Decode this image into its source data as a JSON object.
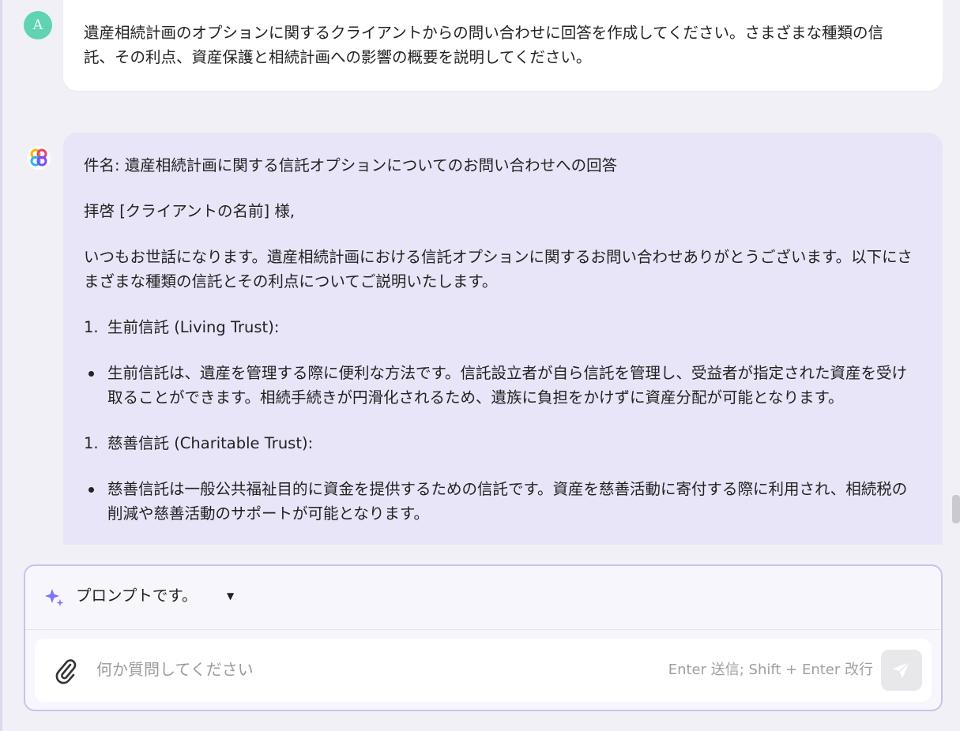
{
  "user": {
    "avatar_letter": "A",
    "message": "遺産相続計画のオプションに関するクライアントからの問い合わせに回答を作成してください。さまざまな種類の信託、その利点、資産保護と相続計画への影響の概要を説明してください。"
  },
  "assistant": {
    "subject": "件名: 遺産相続計画に関する信託オプションについてのお問い合わせへの回答",
    "greeting": "拝啓 [クライアントの名前] 様,",
    "intro": "いつもお世話になります。遺産相続計画における信託オプションに関するお問い合わせありがとうございます。以下にさまざまな種類の信託とその利点についてご説明いたします。",
    "items": [
      {
        "number": "1.",
        "title": "生前信託 (Living Trust):",
        "bullet": "生前信託は、遺産を管理する際に便利な方法です。信託設立者が自ら信託を管理し、受益者が指定された資産を受け取ることができます。相続手続きが円滑化されるため、遺族に負担をかけずに資産分配が可能となります。"
      },
      {
        "number": "1.",
        "title": "慈善信託 (Charitable Trust):",
        "bullet": "慈善信託は一般公共福祉目的に資金を提供するための信託です。資産を慈善活動に寄付する際に利用され、相続税の削減や慈善活動のサポートが可能となります。"
      }
    ]
  },
  "composer": {
    "prompt_label": "プロンプトです。",
    "input_placeholder": "何か質問してください",
    "hint": "Enter 送信; Shift + Enter 改行"
  },
  "icons": {
    "sparkle": "sparkle-icon",
    "attach": "paperclip-icon",
    "send": "send-icon",
    "dropdown": "caret-down-icon"
  },
  "colors": {
    "avatar": "#5fd3b3",
    "assistant_bubble": "#e7e5f7",
    "composer_border": "#c7c2ee"
  }
}
